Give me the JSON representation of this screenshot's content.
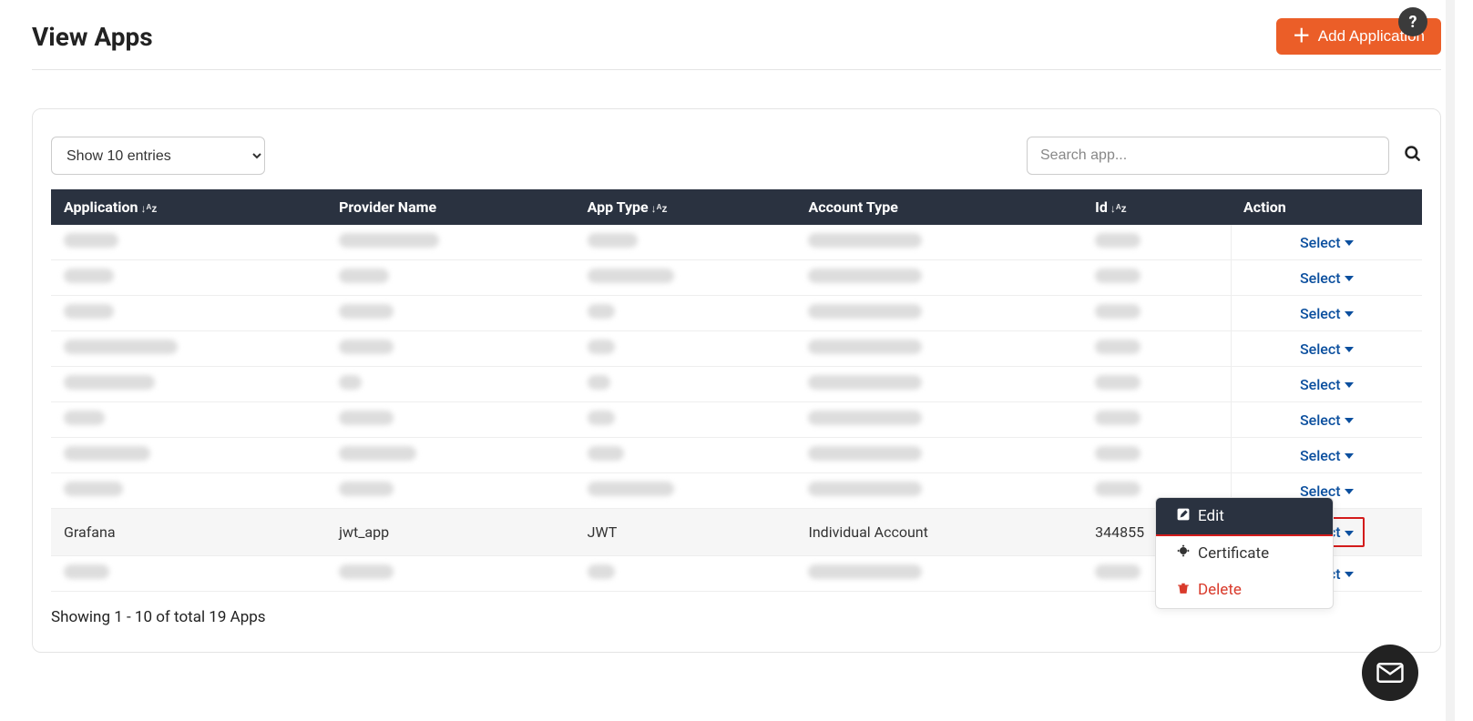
{
  "header": {
    "title": "View Apps",
    "add_button": "Add Application"
  },
  "controls": {
    "entries_select": "Show 10 entries",
    "search_placeholder": "Search app..."
  },
  "table": {
    "columns": {
      "application": "Application",
      "provider": "Provider Name",
      "app_type": "App Type",
      "account_type": "Account Type",
      "id": "Id",
      "action": "Action"
    },
    "action_label": "Select",
    "visible_row": {
      "application": "Grafana",
      "provider": "jwt_app",
      "app_type": "JWT",
      "account_type": "Individual Account",
      "id": "344855"
    },
    "blurred_rows_before": 8,
    "blurred_rows_after": 1
  },
  "dropdown": {
    "edit": "Edit",
    "certificate": "Certificate",
    "delete": "Delete"
  },
  "footer": {
    "text": "Showing 1 - 10 of total 19 Apps"
  }
}
